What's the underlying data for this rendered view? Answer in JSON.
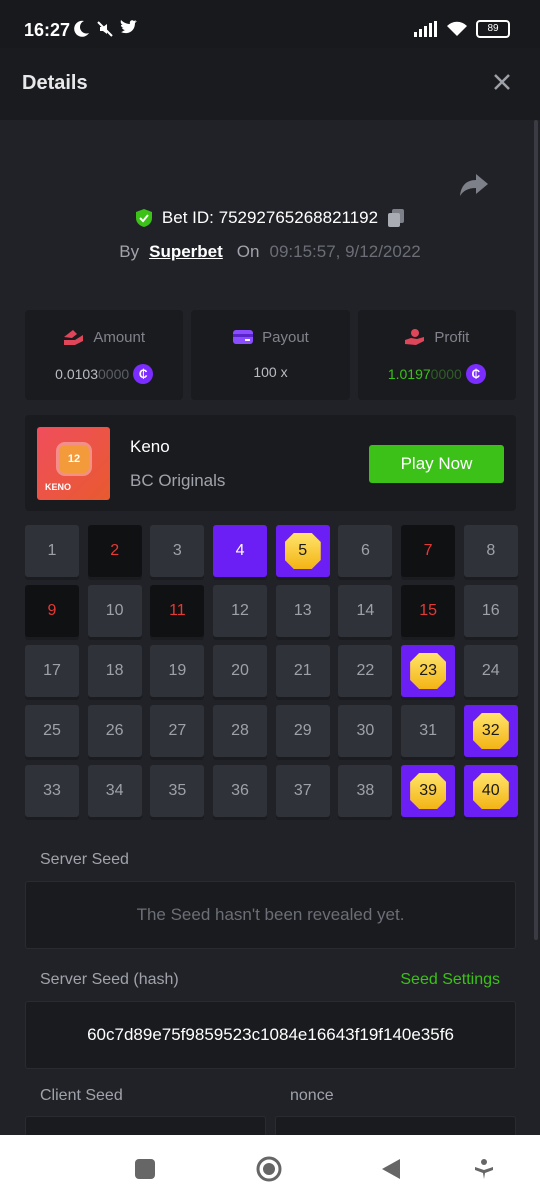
{
  "status": {
    "time": "16:27",
    "battery": "89"
  },
  "header": {
    "title": "Details"
  },
  "bet": {
    "id_label": "Bet ID: 75292765268821192",
    "by_label": "By",
    "house": "Superbet",
    "on_label": "On",
    "datetime": "09:15:57, 9/12/2022"
  },
  "stats": {
    "amount": {
      "label": "Amount",
      "value_main": "0.0103",
      "value_dim": "0000"
    },
    "payout": {
      "label": "Payout",
      "value": "100 x"
    },
    "profit": {
      "label": "Profit",
      "value_main": "1.0197",
      "value_dim": "0000"
    }
  },
  "coin_symbol": "₵",
  "game": {
    "name": "Keno",
    "provider": "BC Originals",
    "play_label": "Play Now",
    "thumb_number": "12",
    "thumb_label": "KENO"
  },
  "grid": [
    {
      "n": "1",
      "s": "normal"
    },
    {
      "n": "2",
      "s": "miss"
    },
    {
      "n": "3",
      "s": "normal"
    },
    {
      "n": "4",
      "s": "sel"
    },
    {
      "n": "5",
      "s": "hit"
    },
    {
      "n": "6",
      "s": "normal"
    },
    {
      "n": "7",
      "s": "miss"
    },
    {
      "n": "8",
      "s": "normal"
    },
    {
      "n": "9",
      "s": "miss"
    },
    {
      "n": "10",
      "s": "normal"
    },
    {
      "n": "11",
      "s": "miss"
    },
    {
      "n": "12",
      "s": "normal"
    },
    {
      "n": "13",
      "s": "normal"
    },
    {
      "n": "14",
      "s": "normal"
    },
    {
      "n": "15",
      "s": "miss"
    },
    {
      "n": "16",
      "s": "normal"
    },
    {
      "n": "17",
      "s": "normal"
    },
    {
      "n": "18",
      "s": "normal"
    },
    {
      "n": "19",
      "s": "normal"
    },
    {
      "n": "20",
      "s": "normal"
    },
    {
      "n": "21",
      "s": "normal"
    },
    {
      "n": "22",
      "s": "normal"
    },
    {
      "n": "23",
      "s": "hit"
    },
    {
      "n": "24",
      "s": "normal"
    },
    {
      "n": "25",
      "s": "normal"
    },
    {
      "n": "26",
      "s": "normal"
    },
    {
      "n": "27",
      "s": "normal"
    },
    {
      "n": "28",
      "s": "normal"
    },
    {
      "n": "29",
      "s": "normal"
    },
    {
      "n": "30",
      "s": "normal"
    },
    {
      "n": "31",
      "s": "normal"
    },
    {
      "n": "32",
      "s": "hit"
    },
    {
      "n": "33",
      "s": "normal"
    },
    {
      "n": "34",
      "s": "normal"
    },
    {
      "n": "35",
      "s": "normal"
    },
    {
      "n": "36",
      "s": "normal"
    },
    {
      "n": "37",
      "s": "normal"
    },
    {
      "n": "38",
      "s": "normal"
    },
    {
      "n": "39",
      "s": "hit"
    },
    {
      "n": "40",
      "s": "hit"
    }
  ],
  "seeds": {
    "server_seed_label": "Server Seed",
    "server_seed_value": "The Seed hasn't been revealed yet.",
    "server_hash_label": "Server Seed (hash)",
    "seed_settings": "Seed Settings",
    "server_hash_value": "60c7d89e75f9859523c1084e16643f19f140e35f6",
    "client_seed_label": "Client Seed",
    "nonce_label": "nonce"
  },
  "colors": {
    "accent": "#6b1ff5",
    "green": "#3bc117",
    "miss": "#e53935",
    "gem": "#f3b415"
  }
}
